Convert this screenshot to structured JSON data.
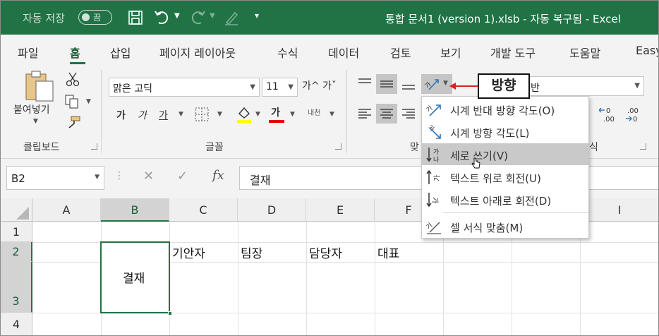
{
  "titlebar": {
    "autosave_label": "자동 저장",
    "autosave_state": "끔",
    "doc_title": "통합 문서1 (version 1).xlsb  -  자동 복구됨  -  Excel"
  },
  "tabs": [
    "파일",
    "홈",
    "삽입",
    "페이지 레이아웃",
    "수식",
    "데이터",
    "검토",
    "보기",
    "개발 도구",
    "도움말",
    "Easy"
  ],
  "ribbon": {
    "paste_label": "붙여넣기",
    "clipboard_label": "클립보드",
    "font_name": "맑은 고딕",
    "font_size": "11",
    "grow_font": "가^",
    "shrink_font": "가ˇ",
    "bold": "가",
    "italic": "가",
    "underline": "가",
    "font_color_glyph": "가",
    "phonetic": "내천",
    "font_label": "글꼴",
    "align_label": "맞",
    "number_format": "반",
    "number_label": "식",
    "dec_increase": "←0\n.00",
    "dec_decrease": ".00\n→0"
  },
  "callout": "방향",
  "orientation_menu": [
    {
      "label": "시계 반대 방향 각도(O)",
      "icon": "angle-counterclockwise-icon"
    },
    {
      "label": "시계 방향 각도(L)",
      "icon": "angle-clockwise-icon"
    },
    {
      "label": "세로 쓰기(V)",
      "icon": "vertical-text-icon"
    },
    {
      "label": "텍스트 위로 회전(U)",
      "icon": "rotate-text-up-icon"
    },
    {
      "label": "텍스트 아래로 회전(D)",
      "icon": "rotate-text-down-icon"
    },
    {
      "label": "셀 서식 맞춤(M)",
      "icon": "format-cell-alignment-icon"
    }
  ],
  "formula_bar": {
    "name_box": "B2",
    "cancel": "✕",
    "enter": "✓",
    "fx": "fx",
    "value": "결재"
  },
  "grid": {
    "columns": [
      "A",
      "B",
      "C",
      "D",
      "E",
      "F",
      "I"
    ],
    "rows": [
      "1",
      "2",
      "3",
      "4"
    ],
    "cells": {
      "B2": "결재",
      "C2": "기안자",
      "D2": "팀장",
      "E2": "담당자",
      "F2": "대표"
    }
  },
  "colors": {
    "accent": "#217346",
    "callout_arrow": "#e02020"
  }
}
